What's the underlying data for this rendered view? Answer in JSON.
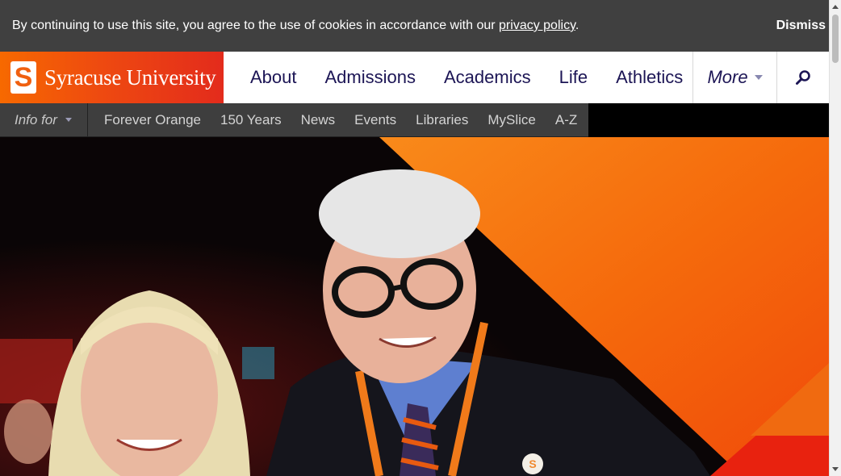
{
  "cookie_bar": {
    "text": "By continuing to use this site, you agree to the use of cookies in accordance with our",
    "link_text": "privacy policy",
    "period": ".",
    "dismiss_label": "Dismiss"
  },
  "header": {
    "logo_mark": "S",
    "logo_text": "Syracuse University",
    "nav": [
      "About",
      "Admissions",
      "Academics",
      "Life",
      "Athletics"
    ],
    "more_label": "More",
    "search_icon": "search-icon"
  },
  "sub_nav": {
    "info_for_label": "Info for",
    "links": [
      "Forever Orange",
      "150 Years",
      "News",
      "Events",
      "Libraries",
      "MySlice",
      "A-Z"
    ]
  },
  "hero": {
    "badge_letter": "S"
  },
  "colors": {
    "orange": "#f76900",
    "navy": "#1c1555",
    "dark_gray": "#404040"
  }
}
